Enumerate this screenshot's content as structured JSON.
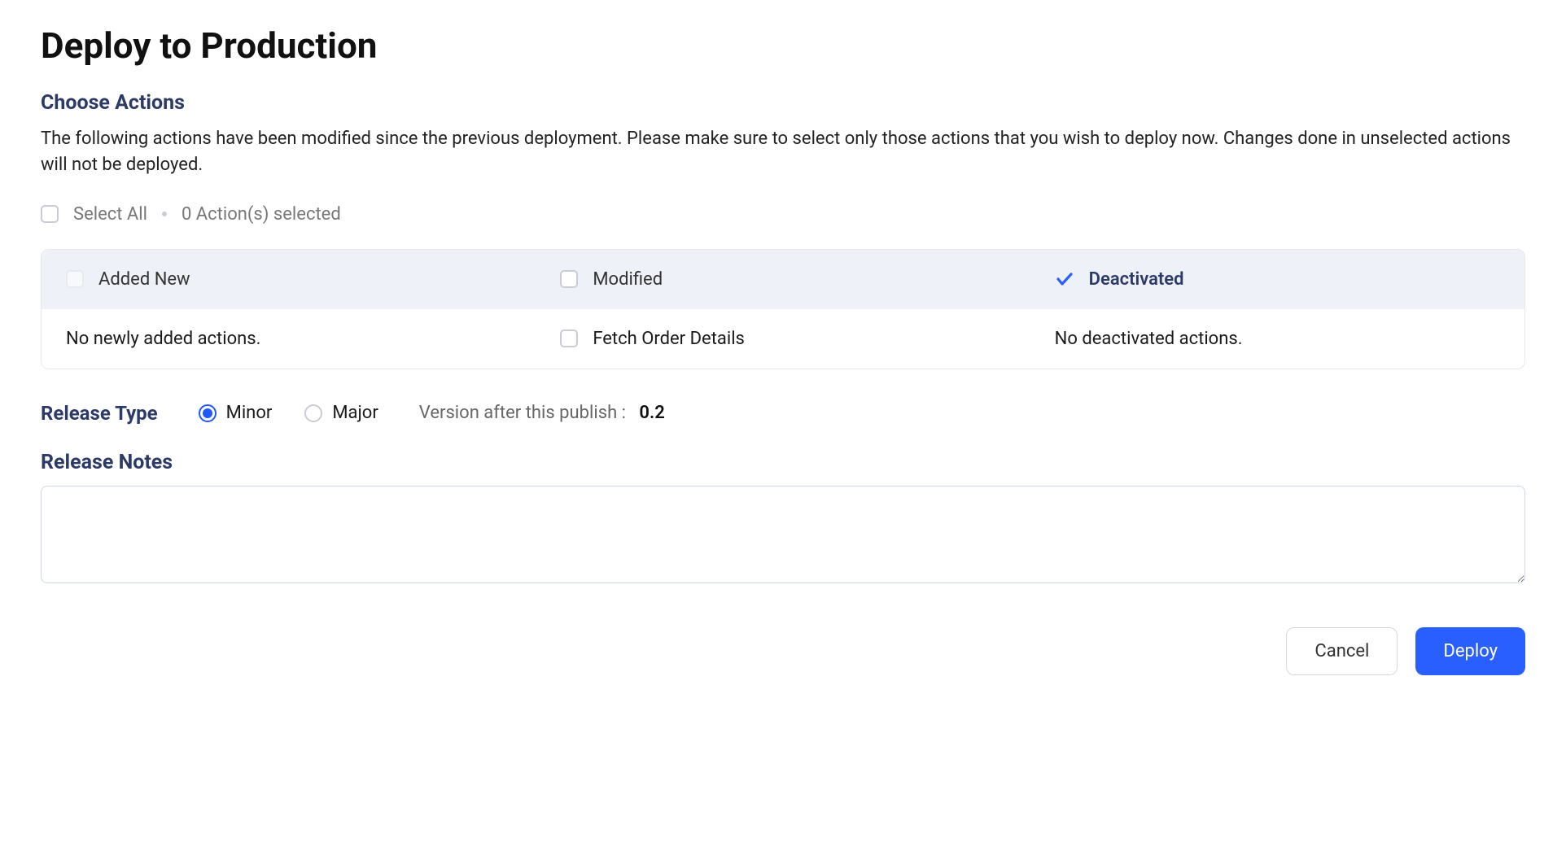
{
  "page_title": "Deploy to Production",
  "choose_actions": {
    "heading": "Choose Actions",
    "description": "The following actions have been modified since the previous deployment. Please make sure to select only those actions that you wish to deploy now. Changes done in unselected actions will not be deployed.",
    "select_all_label": "Select All",
    "selected_count_text": "0 Action(s) selected"
  },
  "columns": {
    "added_new": {
      "label": "Added New",
      "body_text": "No newly added actions."
    },
    "modified": {
      "label": "Modified",
      "items": [
        "Fetch Order Details"
      ]
    },
    "deactivated": {
      "label": "Deactivated",
      "body_text": "No deactivated actions."
    }
  },
  "release_type": {
    "heading": "Release Type",
    "minor_label": "Minor",
    "major_label": "Major",
    "selected": "minor",
    "version_label": "Version after this publish :",
    "version_value": "0.2"
  },
  "release_notes": {
    "heading": "Release Notes",
    "value": ""
  },
  "footer": {
    "cancel_label": "Cancel",
    "deploy_label": "Deploy"
  }
}
